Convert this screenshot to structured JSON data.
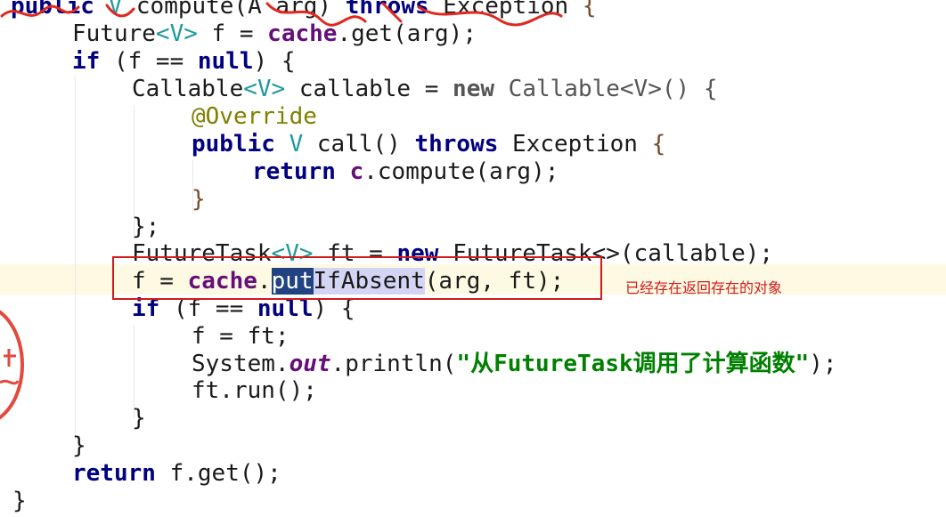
{
  "code_lines": [
    "public V compute(A arg) throws Exception {",
    "    Future<V> f = cache.get(arg);",
    "    if (f == null) {",
    "        Callable<V> callable = new Callable<V>() {",
    "            @Override",
    "            public V call() throws Exception {",
    "                return c.compute(arg);",
    "            }",
    "        };",
    "        FutureTask<V> ft = new FutureTask<>(callable);",
    "        f = cache.putIfAbsent(arg, ft);",
    "        if (f == null) {",
    "            f = ft;",
    "            System.out.println(\"从FutureTask调用了计算函数\");",
    "            ft.run();",
    "        }",
    "    }",
    "    return f.get();",
    "}"
  ],
  "tokens": {
    "public": "public",
    "V": "V",
    "compute_sig": "compute(A arg)",
    "throws": "throws",
    "Exception": "Exception",
    "Future": "Future",
    "lt": "<",
    "gt": ">",
    "f_assign": " f = ",
    "cache": "cache",
    "get_arg": ".get(arg);",
    "if": "if",
    "paren_f_null": " (f == ",
    "null": "null",
    "close_brace_open": ") {",
    "Callable": "Callable",
    "callable_assign": " callable = ",
    "new": "new",
    "Callable_gray": "Callable<V>() {",
    "override": "@Override",
    "call": " call() ",
    "return": "return",
    "c": "c",
    "compute_call": ".compute(arg);",
    "close_brace": "}",
    "close_brace_semi": "};",
    "FutureTask": "FutureTask",
    "ft_assign": " ft = ",
    "FutureTask_ctor": "FutureTask<>(callable);",
    "f_eq": "f = ",
    "dot": ".",
    "put": "put",
    "IfAbsent": "IfAbsent",
    "args_arg_ft": "(arg, ft);",
    "f_eq_ft": "f = ft;",
    "System": "System.",
    "out": "out",
    "println_open": ".println(",
    "string_literal": "\"从FutureTask调用了计算函数\"",
    "println_close": ");",
    "ft_run": "ft.run();",
    "f_get": " f.get();"
  },
  "annotation_note": "已经存在返回存在的对象",
  "colors": {
    "keyword": "#000080",
    "field": "#660e7a",
    "string": "#008000",
    "annotation": "#808000",
    "highlight_box": "#d11b1b",
    "selection": "#214283"
  }
}
